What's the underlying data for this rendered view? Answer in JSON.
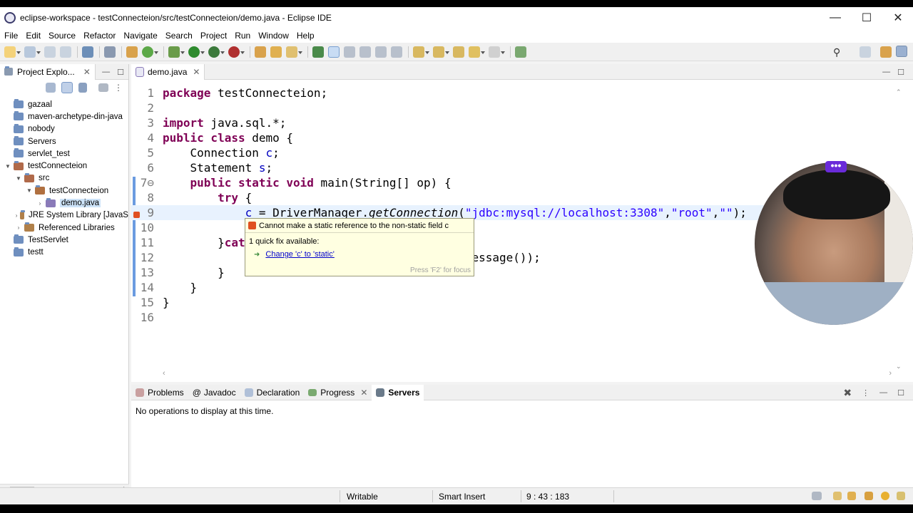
{
  "window": {
    "title": "eclipse-workspace - testConnecteion/src/testConnecteion/demo.java - Eclipse IDE",
    "minimize": "—",
    "maximize": "☐",
    "close": "✕"
  },
  "menu": [
    "File",
    "Edit",
    "Source",
    "Refactor",
    "Navigate",
    "Search",
    "Project",
    "Run",
    "Window",
    "Help"
  ],
  "project_explorer": {
    "tab_label": "Project Explo...",
    "items": [
      {
        "label": "gazaal",
        "indent": 0,
        "twisty": "",
        "icon": "folder-icon"
      },
      {
        "label": "maven-archetype-din-java",
        "indent": 0,
        "twisty": "",
        "icon": "folder-icon"
      },
      {
        "label": "nobody",
        "indent": 0,
        "twisty": "",
        "icon": "folder-icon"
      },
      {
        "label": "Servers",
        "indent": 0,
        "twisty": "",
        "icon": "folder-icon"
      },
      {
        "label": "servlet_test",
        "indent": 0,
        "twisty": "",
        "icon": "folder-icon"
      },
      {
        "label": "testConnecteion",
        "indent": 0,
        "twisty": "▼",
        "icon": "java-project-icon"
      },
      {
        "label": "src",
        "indent": 1,
        "twisty": "▼",
        "icon": "source-folder-icon"
      },
      {
        "label": "testConnecteion",
        "indent": 2,
        "twisty": "▼",
        "icon": "package-icon"
      },
      {
        "label": "demo.java",
        "indent": 3,
        "twisty": "›",
        "icon": "java-file-icon",
        "selected": true
      },
      {
        "label": "JRE System Library [JavaS",
        "indent": 1,
        "twisty": "›",
        "icon": "library-icon"
      },
      {
        "label": "Referenced Libraries",
        "indent": 1,
        "twisty": "›",
        "icon": "library-icon"
      },
      {
        "label": "TestServlet",
        "indent": 0,
        "twisty": "",
        "icon": "folder-icon"
      },
      {
        "label": "testt",
        "indent": 0,
        "twisty": "",
        "icon": "folder-icon"
      }
    ]
  },
  "editor": {
    "tab_label": "demo.java",
    "lines": [
      {
        "n": "1",
        "html": "<span class=\"kw\">package</span> testConnecteion;"
      },
      {
        "n": "2",
        "html": ""
      },
      {
        "n": "3",
        "html": "<span class=\"kw\">import</span> java.sql.*;"
      },
      {
        "n": "4",
        "html": "<span class=\"kw\">public class</span> demo {"
      },
      {
        "n": "5",
        "html": "    Connection <span class=\"fld\">c</span>;"
      },
      {
        "n": "6",
        "html": "    Statement <span class=\"fld\">s</span>;"
      },
      {
        "n": "7⊖",
        "html": "    <span class=\"kw\">public static void</span> main(String[] op) {"
      },
      {
        "n": "8",
        "html": "        <span class=\"kw\">try</span> {"
      },
      {
        "n": "9",
        "html": "            <span class=\"fld\">c</span> = DriverManager.<span class=\"ital\">getConnection</span>(<span class=\"str\">\"jdbc:mysql://localhost:3308\"</span>,<span class=\"str\">\"root\"</span>,<span class=\"str\">\"\"</span>);"
      },
      {
        "n": "10",
        "html": ""
      },
      {
        "n": "11",
        "html": "        }<span class=\"kw\">cat</span>"
      },
      {
        "n": "12",
        "html": "                                          etMessage());"
      },
      {
        "n": "13",
        "html": "        }"
      },
      {
        "n": "14",
        "html": "    }"
      },
      {
        "n": "15",
        "html": "}"
      },
      {
        "n": "16",
        "html": ""
      }
    ]
  },
  "tooltip": {
    "message": "Cannot make a static reference to the non-static field c",
    "quick_fix_count": "1 quick fix available:",
    "fix_label": "Change 'c' to 'static'",
    "footer": "Press 'F2' for focus"
  },
  "bottom_panel": {
    "tabs": [
      "Problems",
      "Javadoc",
      "Declaration",
      "Progress",
      "Servers"
    ],
    "active_tab": "Servers",
    "message": "No operations to display at this time."
  },
  "status": {
    "writable": "Writable",
    "insert_mode": "Smart Insert",
    "position": "9 : 43 : 183"
  },
  "webcam": {
    "menu_label": "•••"
  }
}
